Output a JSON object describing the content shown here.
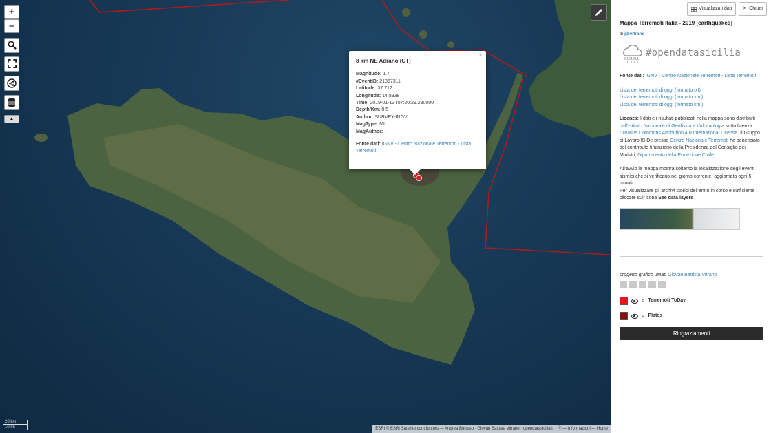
{
  "map": {
    "zoom_in": "+",
    "zoom_out": "−",
    "scale_km": "20 km",
    "scale_mi": "10 mi",
    "attribution": "ESRI © ESRI Satellite contributors — Andrea Borruso · Giovan Battista Vitrano · opendatasicilia.it · ⓘ — Informazioni — Home",
    "marker_color": "#d92020",
    "plates_color": "#b01a1a"
  },
  "popup": {
    "close": "×",
    "title": "8 km NE Adrano (CT)",
    "fields": [
      {
        "label": "Magnitude:",
        "value": "1.7"
      },
      {
        "label": "#EventID:",
        "value": "21367311"
      },
      {
        "label": "Latitude:",
        "value": "37.712"
      },
      {
        "label": "Longitude:",
        "value": "14.8938"
      },
      {
        "label": "Time:",
        "value": "2019-01-13T07:20:29.280000"
      },
      {
        "label": "Depth/Km:",
        "value": "8.5"
      },
      {
        "label": "Author:",
        "value": "SURVEY-INGV"
      },
      {
        "label": "MagType:",
        "value": "ML"
      },
      {
        "label": "MagAuthor:",
        "value": "--"
      }
    ],
    "source_label": "Fonte dati:",
    "source_link": "IGNV - Centro Nazionale Terremoti - Lista Terremoti"
  },
  "sidebar": {
    "view_data": "Visualizza i dati",
    "close": "Chiudi",
    "title": "Mappa Terremoti Italia - 2019 [earthquakes]",
    "author_prefix": "di",
    "author": "gbvitrano",
    "logo_text": "#opendatasicilia",
    "fonte_label": "Fonte dati:",
    "fonte_link": "IGNV - Centro Nazionale Terremoti - Lista Terremoti",
    "lists": [
      "Lista dei terremoti di oggi (formato txt)",
      "Lista dei terremoti di oggi (formato xml)",
      "Lista dei terremoti di oggi (formato kml)"
    ],
    "licence_label": "Licenza:",
    "licence_1": "I dati e i risultati pubblicati nella mappa sono distribuiti",
    "licence_link_1": "dall'Istituto Nazionale di Geofisica e Vulcanologia",
    "licence_2": "sotto licenza",
    "licence_link_2": "Creative Commons Attribution 4.0 International License",
    "licence_3": ". Il Gruppo di Lavoro ISIDe presso",
    "licence_link_3": "Centro Nazionale Terremoti",
    "licence_4": "ha beneficiato del contributo finanziario della Presidenza del Consiglio dei Ministri,",
    "licence_link_4": "Dipartimento della Protezione Civile",
    "intro_1": "All'avvio la mappa mostra soltanto la localizzazione degli eventi sismici che si verificano nel giorno corrente, aggiornata ogni 5 minuti.",
    "intro_2": "Per visualizzare gli archivi storici dell'anno in corso è sufficiente cliccare sull'icona",
    "intro_bold": "See data layers",
    "credit_label": "progetto grafico uMap",
    "credit_link": "Giovan Battista Vitrano",
    "layers": [
      {
        "name": "Terremoti ToDay",
        "color": "#e01919"
      },
      {
        "name": "Plates",
        "color": "#8a1010"
      }
    ],
    "thanks": "Ringraziamenti"
  }
}
